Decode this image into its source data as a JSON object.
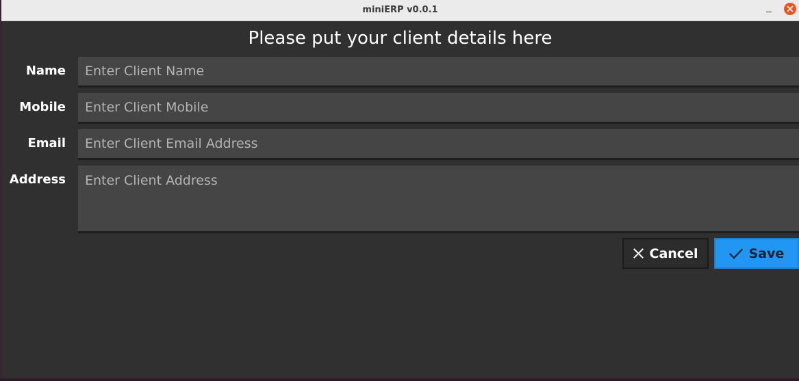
{
  "window": {
    "title": "miniERP v0.0.1",
    "minimize_glyph": "–"
  },
  "form": {
    "heading": "Please put your client details here",
    "fields": {
      "name": {
        "label": "Name",
        "placeholder": "Enter Client Name",
        "value": ""
      },
      "mobile": {
        "label": "Mobile",
        "placeholder": "Enter Client Mobile",
        "value": ""
      },
      "email": {
        "label": "Email",
        "placeholder": "Enter Client Email Address",
        "value": ""
      },
      "address": {
        "label": "Address",
        "placeholder": "Enter Client Address",
        "value": ""
      }
    }
  },
  "actions": {
    "cancel_label": "Cancel",
    "cancel_icon": "close-icon",
    "save_label": "Save",
    "save_icon": "check-icon"
  },
  "colors": {
    "background": "#303030",
    "field_background": "#454545",
    "accent": "#2196f3",
    "close_button": "#e95420"
  }
}
